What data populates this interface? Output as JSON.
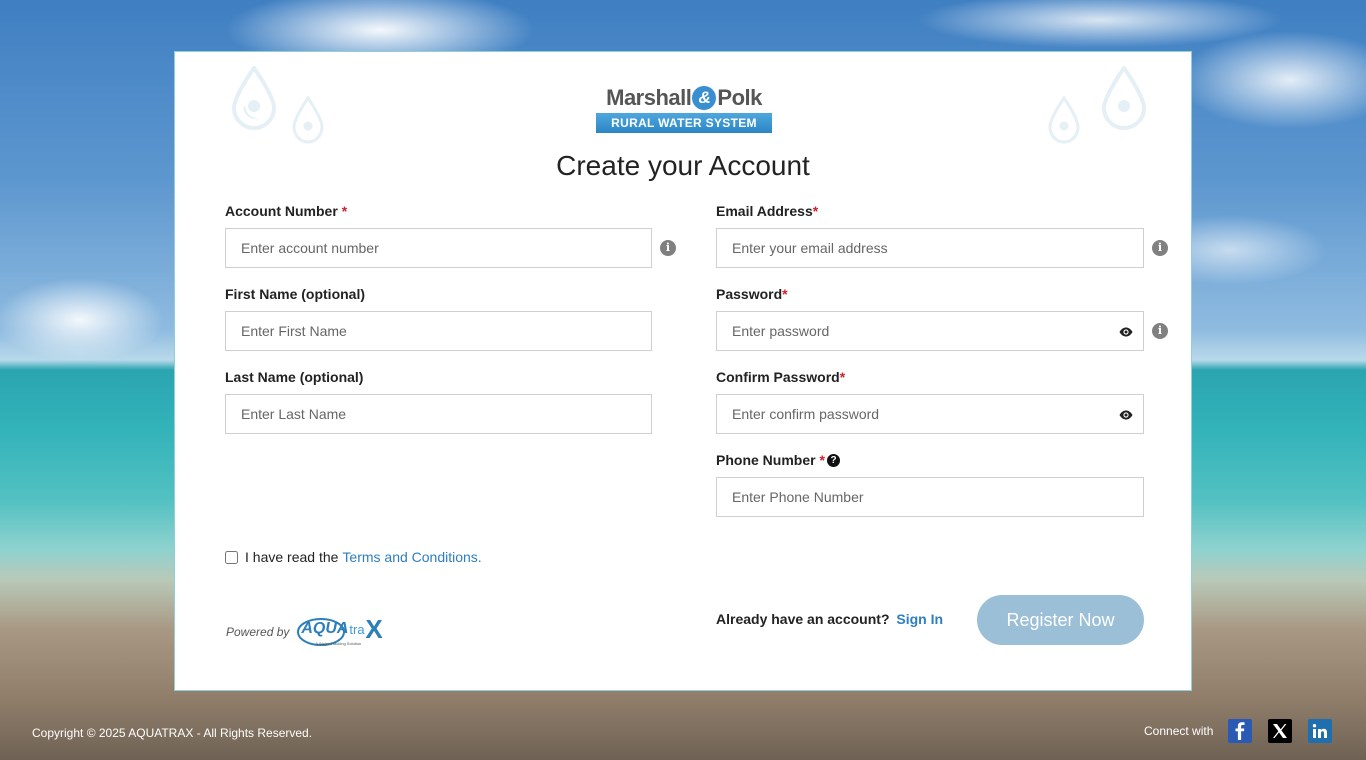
{
  "brand": {
    "logo_top_left": "Marshall",
    "logo_amp": "&",
    "logo_top_right": "Polk",
    "logo_bottom": "RURAL WATER SYSTEM"
  },
  "page_title": "Create your Account",
  "form": {
    "account_number": {
      "label": "Account Number",
      "required": "*",
      "placeholder": "Enter account number"
    },
    "email": {
      "label": "Email Address",
      "required": "*",
      "placeholder": "Enter your email address"
    },
    "first_name": {
      "label": "First Name (optional)",
      "placeholder": "Enter First Name"
    },
    "password": {
      "label": "Password",
      "required": "*",
      "placeholder": "Enter password"
    },
    "last_name": {
      "label": "Last Name (optional)",
      "placeholder": "Enter Last Name"
    },
    "confirm_password": {
      "label": "Confirm Password",
      "required": "*",
      "placeholder": "Enter confirm password"
    },
    "phone": {
      "label": "Phone Number",
      "required": "*",
      "placeholder": "Enter Phone Number"
    }
  },
  "terms": {
    "prefix": "I have read the",
    "link": "Terms and Conditions."
  },
  "powered": {
    "text": "Powered by",
    "brand_a": "AQUA",
    "brand_b": "tra",
    "brand_c": "X",
    "tagline": "A Water Tracking Solution"
  },
  "signin": {
    "prompt": "Already have an account?",
    "link": "Sign In"
  },
  "register_button": "Register Now",
  "footer": {
    "copyright": "Copyright © 2025 AQUATRAX - All Rights Reserved.",
    "connect": "Connect with"
  },
  "colors": {
    "accent": "#2d7fc1",
    "button": "#9bbfd6",
    "required": "#d0202e"
  },
  "icons": [
    "water-drop-icon",
    "info-icon",
    "eye-icon",
    "question-icon",
    "facebook-icon",
    "x-icon",
    "linkedin-icon"
  ]
}
